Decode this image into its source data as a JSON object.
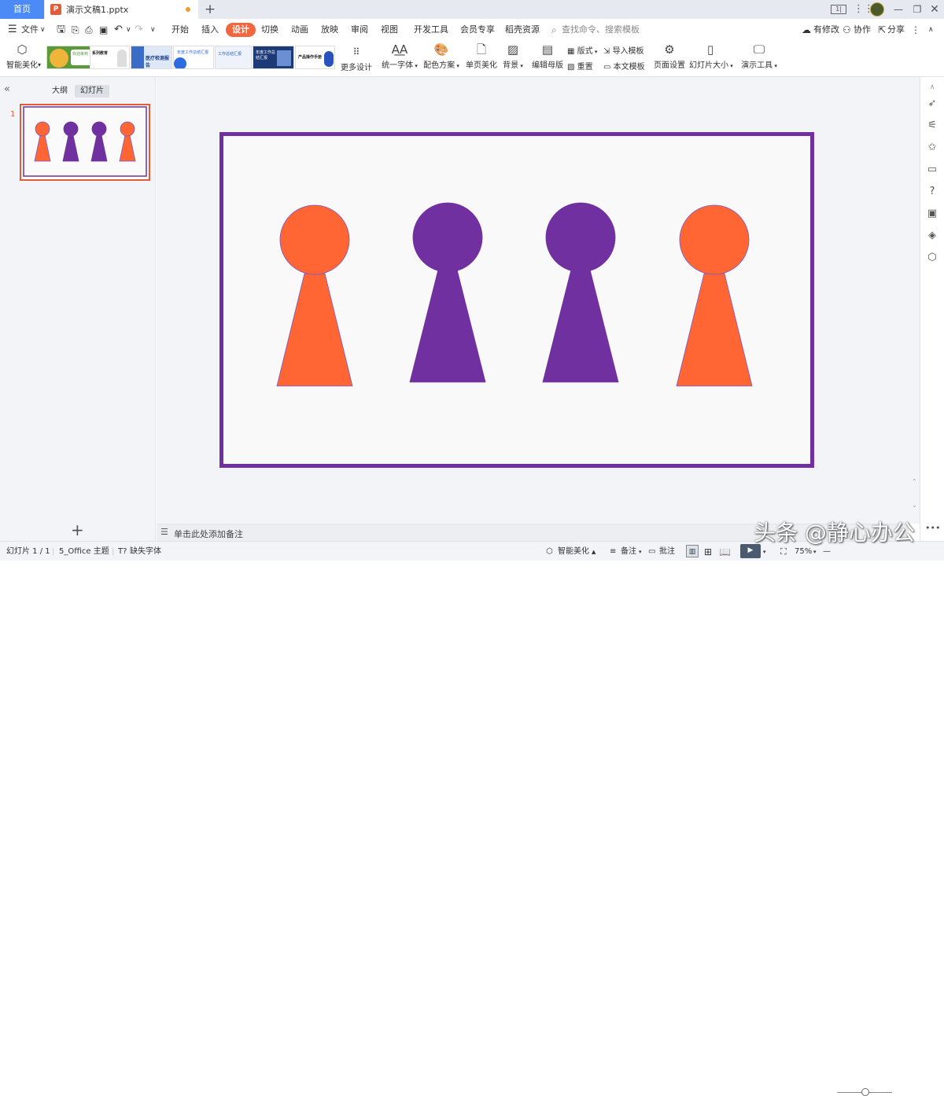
{
  "tabs": {
    "home": "首页",
    "document": "演示文稿1.pptx",
    "new_tab": "+"
  },
  "menubar": {
    "file": "文件",
    "items": [
      "开始",
      "插入",
      "设计",
      "切换",
      "动画",
      "放映",
      "审阅",
      "视图",
      "开发工具",
      "会员专享",
      "稻壳资源"
    ],
    "active": "设计",
    "search_placeholder": "查找命令、搜索模板",
    "has_changes": "有修改",
    "collaborate": "协作",
    "share": "分享"
  },
  "ribbon": {
    "smart_beautify": "智能美化",
    "more_designs": "更多设计",
    "unify_font": "统一字体",
    "color_scheme": "配色方案",
    "single_page_beautify": "单页美化",
    "background": "背景",
    "edit_master": "编辑母版",
    "layout": "版式",
    "reset": "重置",
    "import_template": "导入模板",
    "text_template": "本文模板",
    "page_setup": "页面设置",
    "slide_size": "幻灯片大小",
    "presentation_tools": "演示工具",
    "template_thumbs": [
      "欢迎来到",
      "系列教育",
      "医疗检测报告",
      "年度工作总结汇报",
      "工作总结汇报",
      "年度工作总结汇报",
      "产品操作手册"
    ]
  },
  "left_panel": {
    "tab_outline": "大纲",
    "tab_slides": "幻灯片",
    "slide_number": "1",
    "add_slide": "+"
  },
  "notes_placeholder": "单击此处添加备注",
  "statusbar": {
    "slide_counter": "幻灯片 1 / 1",
    "theme": "5_Office 主题",
    "missing_font": "缺失字体",
    "smart_beautify": "智能美化",
    "notes": "备注",
    "comments": "批注",
    "zoom": "75%"
  },
  "watermark": "头条 @静心办公",
  "colors": {
    "accent": "#f4673e",
    "orange_figure": "#ff6633",
    "purple_figure": "#7030a0",
    "slide_border": "#7030a0"
  },
  "slide": {
    "figures": [
      {
        "color": "orange"
      },
      {
        "color": "purple"
      },
      {
        "color": "purple"
      },
      {
        "color": "orange"
      }
    ]
  }
}
